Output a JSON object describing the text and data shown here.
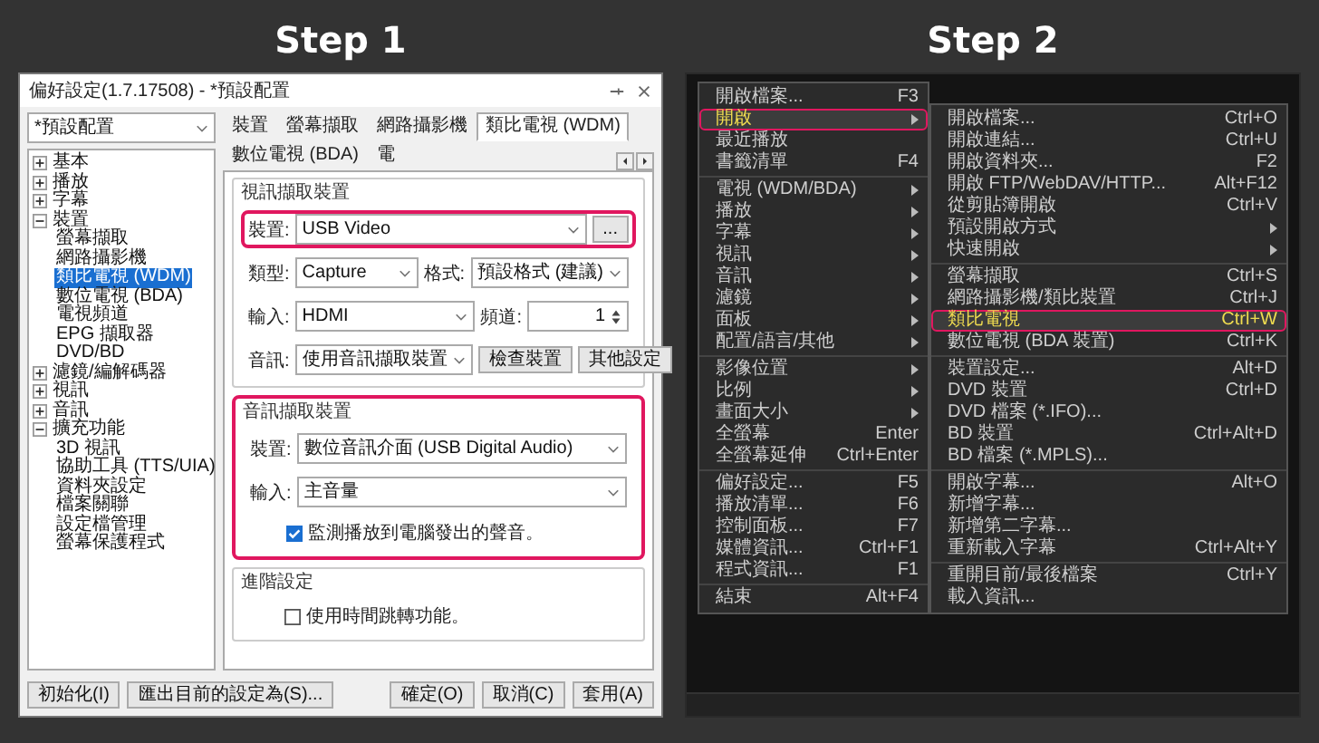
{
  "step_1": {
    "heading": "Step 1",
    "window": {
      "title": "偏好設定(1.7.17508) - *預設配置",
      "preset": "*預設配置",
      "tree": [
        {
          "label": "基本",
          "expanded": false,
          "selected": false
        },
        {
          "label": "播放",
          "expanded": false,
          "selected": false
        },
        {
          "label": "字幕",
          "expanded": false,
          "selected": false
        },
        {
          "label": "裝置",
          "expanded": true,
          "selected": false,
          "children": [
            {
              "label": "螢幕擷取",
              "selected": false
            },
            {
              "label": "網路攝影機",
              "selected": false
            },
            {
              "label": "類比電視 (WDM)",
              "selected": true
            },
            {
              "label": "數位電視 (BDA)",
              "selected": false
            },
            {
              "label": "電視頻道",
              "selected": false
            },
            {
              "label": "EPG 擷取器",
              "selected": false
            },
            {
              "label": "DVD/BD",
              "selected": false
            }
          ]
        },
        {
          "label": "濾鏡/編解碼器",
          "expanded": false,
          "selected": false
        },
        {
          "label": "視訊",
          "expanded": false,
          "selected": false
        },
        {
          "label": "音訊",
          "expanded": false,
          "selected": false
        },
        {
          "label": "擴充功能",
          "expanded": true,
          "selected": false,
          "children": [
            {
              "label": "3D 視訊",
              "selected": false
            },
            {
              "label": "協助工具 (TTS/UIA)",
              "selected": false
            },
            {
              "label": "資料夾設定",
              "selected": false
            },
            {
              "label": "檔案關聯",
              "selected": false
            },
            {
              "label": "設定檔管理",
              "selected": false
            },
            {
              "label": "螢幕保護程式",
              "selected": false
            }
          ]
        }
      ],
      "tabs": [
        {
          "label": "裝置",
          "selected": false
        },
        {
          "label": "螢幕擷取",
          "selected": false
        },
        {
          "label": "網路攝影機",
          "selected": false
        },
        {
          "label": "類比電視 (WDM)",
          "selected": true
        },
        {
          "label": "數位電視 (BDA)",
          "selected": false
        },
        {
          "label": "電",
          "selected": false
        }
      ],
      "groups": [
        {
          "title": "視訊擷取裝置",
          "highlighted": false,
          "rows": [
            {
              "highlighted": true,
              "fields": [
                {
                  "kind": "select",
                  "label": "裝置:",
                  "value": "USB Video"
                },
                {
                  "kind": "button",
                  "label": "..."
                }
              ]
            },
            {
              "highlighted": false,
              "fields": [
                {
                  "kind": "select",
                  "label": "類型:",
                  "value": "Capture"
                },
                {
                  "kind": "select",
                  "label": "格式:",
                  "value": "預設格式 (建議)"
                }
              ]
            },
            {
              "highlighted": false,
              "fields": [
                {
                  "kind": "select",
                  "label": "輸入:",
                  "value": "HDMI"
                },
                {
                  "kind": "spin",
                  "label": "頻道:",
                  "value": "1"
                }
              ]
            },
            {
              "highlighted": false,
              "fields": [
                {
                  "kind": "select",
                  "label": "音訊:",
                  "value": "使用音訊擷取裝置"
                },
                {
                  "kind": "button",
                  "label": "檢查裝置"
                },
                {
                  "kind": "button",
                  "label": "其他設定"
                }
              ]
            }
          ]
        },
        {
          "title": "音訊擷取裝置",
          "highlighted": true,
          "rows": [
            {
              "highlighted": false,
              "fields": [
                {
                  "kind": "select",
                  "label": "裝置:",
                  "value": "數位音訊介面 (USB Digital Audio)"
                }
              ]
            },
            {
              "highlighted": false,
              "fields": [
                {
                  "kind": "select",
                  "label": "輸入:",
                  "value": "主音量"
                }
              ]
            },
            {
              "highlighted": false,
              "fields": [
                {
                  "kind": "checkbox",
                  "label": "監測播放到電腦發出的聲音。",
                  "checked": true
                }
              ]
            }
          ]
        },
        {
          "title": "進階設定",
          "highlighted": false,
          "rows": [
            {
              "highlighted": false,
              "fields": [
                {
                  "kind": "checkbox",
                  "label": "使用時間跳轉功能。",
                  "checked": false
                }
              ]
            }
          ]
        }
      ],
      "left_buttons": [
        "初始化(I)",
        "匯出目前的設定為(S)..."
      ],
      "right_buttons": [
        "確定(O)",
        "取消(C)",
        "套用(A)"
      ]
    }
  },
  "step_2": {
    "heading": "Step 2",
    "menu": [
      {
        "kind": "item",
        "label": "開啟檔案...",
        "shortcut": "F3",
        "submenu": false,
        "selected": false,
        "highlighted": false
      },
      {
        "kind": "item",
        "label": "開啟",
        "submenu": true,
        "selected": true,
        "highlighted": true
      },
      {
        "kind": "item",
        "label": "最近播放",
        "submenu": false,
        "selected": false,
        "highlighted": false
      },
      {
        "kind": "item",
        "label": "書籤清單",
        "shortcut": "F4",
        "submenu": false,
        "selected": false,
        "highlighted": false
      },
      {
        "kind": "separator"
      },
      {
        "kind": "item",
        "label": "電視 (WDM/BDA)",
        "submenu": true,
        "selected": false,
        "highlighted": false
      },
      {
        "kind": "item",
        "label": "播放",
        "submenu": true,
        "selected": false,
        "highlighted": false
      },
      {
        "kind": "item",
        "label": "字幕",
        "submenu": true,
        "selected": false,
        "highlighted": false
      },
      {
        "kind": "item",
        "label": "視訊",
        "submenu": true,
        "selected": false,
        "highlighted": false
      },
      {
        "kind": "item",
        "label": "音訊",
        "submenu": true,
        "selected": false,
        "highlighted": false
      },
      {
        "kind": "item",
        "label": "濾鏡",
        "submenu": true,
        "selected": false,
        "highlighted": false
      },
      {
        "kind": "item",
        "label": "面板",
        "submenu": true,
        "selected": false,
        "highlighted": false
      },
      {
        "kind": "item",
        "label": "配置/語言/其他",
        "submenu": true,
        "selected": false,
        "highlighted": false
      },
      {
        "kind": "separator"
      },
      {
        "kind": "item",
        "label": "影像位置",
        "submenu": true,
        "selected": false,
        "highlighted": false
      },
      {
        "kind": "item",
        "label": "比例",
        "submenu": true,
        "selected": false,
        "highlighted": false
      },
      {
        "kind": "item",
        "label": "畫面大小",
        "submenu": true,
        "selected": false,
        "highlighted": false
      },
      {
        "kind": "item",
        "label": "全螢幕",
        "shortcut": "Enter",
        "submenu": false,
        "selected": false,
        "highlighted": false
      },
      {
        "kind": "item",
        "label": "全螢幕延伸",
        "shortcut": "Ctrl+Enter",
        "submenu": false,
        "selected": false,
        "highlighted": false
      },
      {
        "kind": "separator"
      },
      {
        "kind": "item",
        "label": "偏好設定...",
        "shortcut": "F5",
        "submenu": false,
        "selected": false,
        "highlighted": false
      },
      {
        "kind": "item",
        "label": "播放清單...",
        "shortcut": "F6",
        "submenu": false,
        "selected": false,
        "highlighted": false
      },
      {
        "kind": "item",
        "label": "控制面板...",
        "shortcut": "F7",
        "submenu": false,
        "selected": false,
        "highlighted": false
      },
      {
        "kind": "item",
        "label": "媒體資訊...",
        "shortcut": "Ctrl+F1",
        "submenu": false,
        "selected": false,
        "highlighted": false
      },
      {
        "kind": "item",
        "label": "程式資訊...",
        "shortcut": "F1",
        "submenu": false,
        "selected": false,
        "highlighted": false
      },
      {
        "kind": "separator"
      },
      {
        "kind": "item",
        "label": "結束",
        "shortcut": "Alt+F4",
        "submenu": false,
        "selected": false,
        "highlighted": false
      }
    ],
    "submenu": [
      {
        "kind": "item",
        "label": "開啟檔案...",
        "shortcut": "Ctrl+O",
        "submenu": false,
        "selected": false,
        "highlighted": false
      },
      {
        "kind": "item",
        "label": "開啟連結...",
        "shortcut": "Ctrl+U",
        "submenu": false,
        "selected": false,
        "highlighted": false
      },
      {
        "kind": "item",
        "label": "開啟資料夾...",
        "shortcut": "F2",
        "submenu": false,
        "selected": false,
        "highlighted": false
      },
      {
        "kind": "item",
        "label": "開啟 FTP/WebDAV/HTTP...",
        "shortcut": "Alt+F12",
        "submenu": false,
        "selected": false,
        "highlighted": false
      },
      {
        "kind": "item",
        "label": "從剪貼簿開啟",
        "shortcut": "Ctrl+V",
        "submenu": false,
        "selected": false,
        "highlighted": false
      },
      {
        "kind": "item",
        "label": "預設開啟方式",
        "submenu": true,
        "selected": false,
        "highlighted": false
      },
      {
        "kind": "item",
        "label": "快速開啟",
        "submenu": true,
        "selected": false,
        "highlighted": false
      },
      {
        "kind": "separator"
      },
      {
        "kind": "item",
        "label": "螢幕擷取",
        "shortcut": "Ctrl+S",
        "submenu": false,
        "selected": false,
        "highlighted": false
      },
      {
        "kind": "item",
        "label": "網路攝影機/類比裝置",
        "shortcut": "Ctrl+J",
        "submenu": false,
        "selected": false,
        "highlighted": false
      },
      {
        "kind": "item",
        "label": "類比電視",
        "shortcut": "Ctrl+W",
        "submenu": false,
        "selected": true,
        "highlighted": true
      },
      {
        "kind": "item",
        "label": "數位電視 (BDA 裝置)",
        "shortcut": "Ctrl+K",
        "submenu": false,
        "selected": false,
        "highlighted": false
      },
      {
        "kind": "separator"
      },
      {
        "kind": "item",
        "label": "裝置設定...",
        "shortcut": "Alt+D",
        "submenu": false,
        "selected": false,
        "highlighted": false
      },
      {
        "kind": "item",
        "label": "DVD 裝置",
        "shortcut": "Ctrl+D",
        "submenu": false,
        "selected": false,
        "highlighted": false
      },
      {
        "kind": "item",
        "label": "DVD 檔案 (*.IFO)...",
        "submenu": false,
        "selected": false,
        "highlighted": false
      },
      {
        "kind": "item",
        "label": "BD 裝置",
        "shortcut": "Ctrl+Alt+D",
        "submenu": false,
        "selected": false,
        "highlighted": false
      },
      {
        "kind": "item",
        "label": "BD 檔案 (*.MPLS)...",
        "submenu": false,
        "selected": false,
        "highlighted": false
      },
      {
        "kind": "separator"
      },
      {
        "kind": "item",
        "label": "開啟字幕...",
        "shortcut": "Alt+O",
        "submenu": false,
        "selected": false,
        "highlighted": false
      },
      {
        "kind": "item",
        "label": "新增字幕...",
        "submenu": false,
        "selected": false,
        "highlighted": false
      },
      {
        "kind": "item",
        "label": "新增第二字幕...",
        "submenu": false,
        "selected": false,
        "highlighted": false
      },
      {
        "kind": "item",
        "label": "重新載入字幕",
        "shortcut": "Ctrl+Alt+Y",
        "submenu": false,
        "selected": false,
        "highlighted": false
      },
      {
        "kind": "separator"
      },
      {
        "kind": "item",
        "label": "重開目前/最後檔案",
        "shortcut": "Ctrl+Y",
        "submenu": false,
        "selected": false,
        "highlighted": false
      },
      {
        "kind": "item",
        "label": "載入資訊...",
        "submenu": false,
        "selected": false,
        "highlighted": false
      }
    ]
  }
}
